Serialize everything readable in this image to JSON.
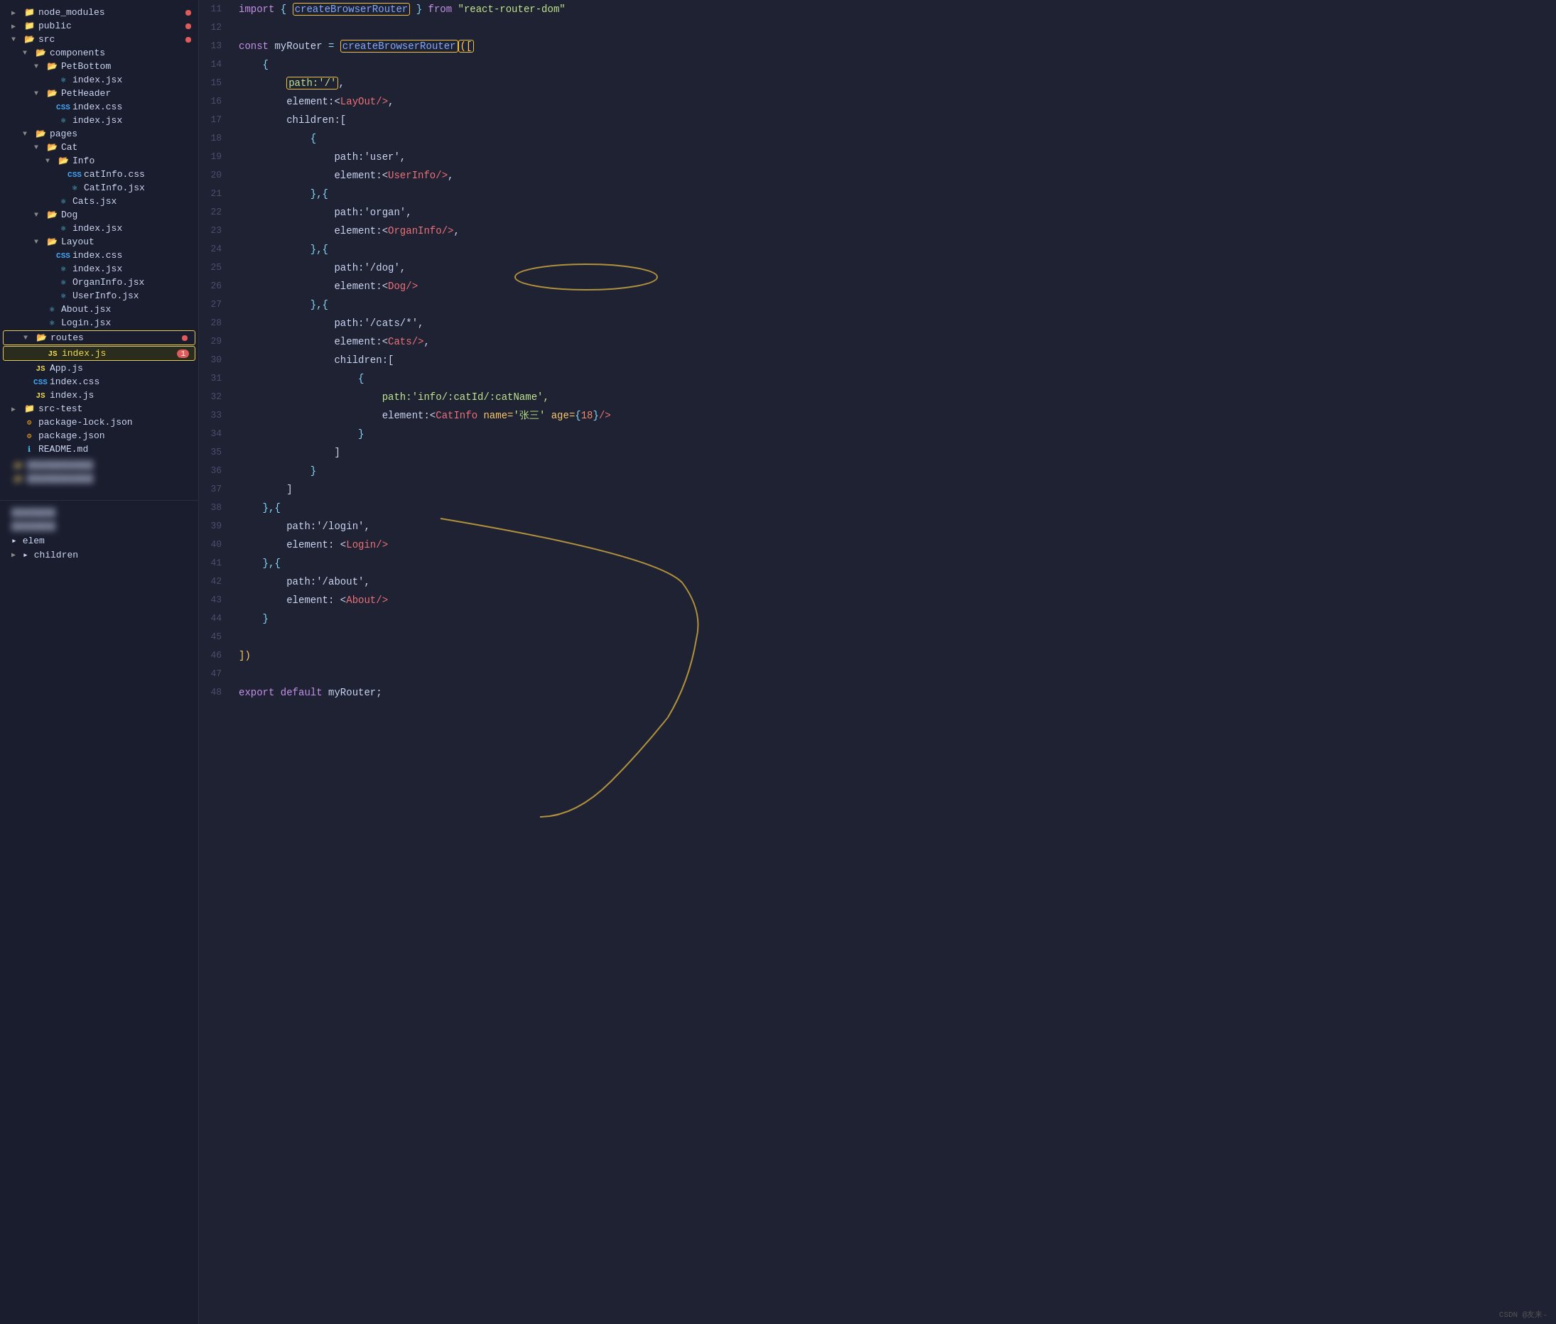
{
  "sidebar": {
    "items": [
      {
        "id": "node_modules",
        "label": "node_modules",
        "indent": 1,
        "type": "folder-collapsed",
        "arrow": "▶",
        "badge": "dot"
      },
      {
        "id": "public",
        "label": "public",
        "indent": 1,
        "type": "folder-collapsed",
        "arrow": "▶",
        "badge": "dot"
      },
      {
        "id": "src",
        "label": "src",
        "indent": 1,
        "type": "folder-open",
        "arrow": "▼",
        "badge": "dot-red"
      },
      {
        "id": "components",
        "label": "components",
        "indent": 2,
        "type": "folder-open",
        "arrow": "▼"
      },
      {
        "id": "PetBottom",
        "label": "PetBottom",
        "indent": 3,
        "type": "folder-open",
        "arrow": "▼"
      },
      {
        "id": "PetBottom-index",
        "label": "index.jsx",
        "indent": 4,
        "type": "jsx"
      },
      {
        "id": "PetHeader",
        "label": "PetHeader",
        "indent": 3,
        "type": "folder-open",
        "arrow": "▼"
      },
      {
        "id": "PetHeader-css",
        "label": "index.css",
        "indent": 4,
        "type": "css"
      },
      {
        "id": "PetHeader-jsx",
        "label": "index.jsx",
        "indent": 4,
        "type": "jsx"
      },
      {
        "id": "pages",
        "label": "pages",
        "indent": 2,
        "type": "folder-open",
        "arrow": "▼"
      },
      {
        "id": "Cat",
        "label": "Cat",
        "indent": 3,
        "type": "folder-open",
        "arrow": "▼"
      },
      {
        "id": "Info",
        "label": "Info",
        "indent": 4,
        "type": "folder-open",
        "arrow": "▼"
      },
      {
        "id": "catInfo-css",
        "label": "catInfo.css",
        "indent": 5,
        "type": "css"
      },
      {
        "id": "CatInfo-jsx",
        "label": "CatInfo.jsx",
        "indent": 5,
        "type": "jsx"
      },
      {
        "id": "Cats-jsx",
        "label": "Cats.jsx",
        "indent": 4,
        "type": "jsx"
      },
      {
        "id": "Dog",
        "label": "Dog",
        "indent": 3,
        "type": "folder-open",
        "arrow": "▼"
      },
      {
        "id": "Dog-index",
        "label": "index.jsx",
        "indent": 4,
        "type": "jsx"
      },
      {
        "id": "Layout",
        "label": "Layout",
        "indent": 3,
        "type": "folder-open",
        "arrow": "▼"
      },
      {
        "id": "Layout-css",
        "label": "index.css",
        "indent": 4,
        "type": "css"
      },
      {
        "id": "Layout-jsx",
        "label": "index.jsx",
        "indent": 4,
        "type": "jsx"
      },
      {
        "id": "OrganInfo-jsx",
        "label": "OrganInfo.jsx",
        "indent": 4,
        "type": "jsx"
      },
      {
        "id": "UserInfo-jsx",
        "label": "UserInfo.jsx",
        "indent": 4,
        "type": "jsx"
      },
      {
        "id": "About-jsx",
        "label": "About.jsx",
        "indent": 3,
        "type": "jsx"
      },
      {
        "id": "Login-jsx",
        "label": "Login.jsx",
        "indent": 3,
        "type": "jsx"
      },
      {
        "id": "routes",
        "label": "routes",
        "indent": 2,
        "type": "folder-open-highlighted",
        "arrow": "▼",
        "badge": "dot-red"
      },
      {
        "id": "routes-index",
        "label": "index.js",
        "indent": 3,
        "type": "js-highlighted",
        "badge": "1"
      },
      {
        "id": "App-js",
        "label": "App.js",
        "indent": 2,
        "type": "js"
      },
      {
        "id": "index-css",
        "label": "index.css",
        "indent": 2,
        "type": "css"
      },
      {
        "id": "index-js2",
        "label": "index.js",
        "indent": 2,
        "type": "js"
      },
      {
        "id": "src-test",
        "label": "src-test",
        "indent": 1,
        "type": "folder-collapsed",
        "arrow": "▶"
      },
      {
        "id": "package-lock",
        "label": "package-lock.json",
        "indent": 1,
        "type": "json"
      },
      {
        "id": "package-json",
        "label": "package.json",
        "indent": 1,
        "type": "json"
      },
      {
        "id": "README",
        "label": "README.md",
        "indent": 1,
        "type": "md"
      }
    ],
    "bottom_blurred_1": "████████████",
    "bottom_blurred_2": "████████████",
    "bottom_section": {
      "item1": "████████",
      "item2": "████████",
      "item3": "elem▸",
      "item4": "▸ children"
    }
  },
  "editor": {
    "lines": [
      {
        "num": 11,
        "tokens": [
          {
            "t": "import ",
            "c": "import-kw"
          },
          {
            "t": "{ ",
            "c": "curly"
          },
          {
            "t": "createBrowserRouter",
            "c": "fn",
            "hl": true
          },
          {
            "t": " }",
            "c": "curly"
          },
          {
            "t": " from ",
            "c": "from-kw"
          },
          {
            "t": "\"react-router-dom\"",
            "c": "str"
          }
        ]
      },
      {
        "num": 12,
        "tokens": []
      },
      {
        "num": 13,
        "tokens": [
          {
            "t": "const ",
            "c": "const-kw"
          },
          {
            "t": "myRouter ",
            "c": "var-name"
          },
          {
            "t": "= ",
            "c": "assign"
          },
          {
            "t": "createBrowserRouter",
            "c": "fn",
            "hl2": true
          },
          {
            "t": "([",
            "c": "bracket",
            "hl2": true
          }
        ]
      },
      {
        "num": 14,
        "tokens": [
          {
            "t": "    {",
            "c": "curly"
          }
        ]
      },
      {
        "num": 15,
        "tokens": [
          {
            "t": "        ",
            "c": "plain"
          },
          {
            "t": "path:'/'",
            "c": "path-str",
            "hl": true
          },
          {
            "t": ",",
            "c": "plain"
          }
        ]
      },
      {
        "num": 16,
        "tokens": [
          {
            "t": "        element:<",
            "c": "plain"
          },
          {
            "t": "LayOut",
            "c": "jsx-tag"
          },
          {
            "t": "/>",
            "c": "jsx-slash"
          },
          {
            "t": ",",
            "c": "plain"
          }
        ]
      },
      {
        "num": 17,
        "tokens": [
          {
            "t": "        children:[",
            "c": "plain"
          }
        ]
      },
      {
        "num": 18,
        "tokens": [
          {
            "t": "            {",
            "c": "curly"
          }
        ]
      },
      {
        "num": 19,
        "tokens": [
          {
            "t": "                path:'user',",
            "c": "plain"
          }
        ]
      },
      {
        "num": 20,
        "tokens": [
          {
            "t": "                element:<",
            "c": "plain"
          },
          {
            "t": "UserInfo",
            "c": "jsx-tag"
          },
          {
            "t": "/>",
            "c": "jsx-slash"
          },
          {
            "t": ",",
            "c": "plain"
          }
        ]
      },
      {
        "num": 21,
        "tokens": [
          {
            "t": "            },{",
            "c": "curly"
          }
        ]
      },
      {
        "num": 22,
        "tokens": [
          {
            "t": "                path:'organ',",
            "c": "plain"
          }
        ]
      },
      {
        "num": 23,
        "tokens": [
          {
            "t": "                element:<",
            "c": "plain"
          },
          {
            "t": "OrganInfo",
            "c": "jsx-tag"
          },
          {
            "t": "/>",
            "c": "jsx-slash"
          },
          {
            "t": ",",
            "c": "plain"
          }
        ]
      },
      {
        "num": 24,
        "tokens": [
          {
            "t": "            },{",
            "c": "curly"
          }
        ]
      },
      {
        "num": 25,
        "tokens": [
          {
            "t": "                path:'/dog',",
            "c": "plain"
          }
        ]
      },
      {
        "num": 26,
        "tokens": [
          {
            "t": "                element:<",
            "c": "plain"
          },
          {
            "t": "Dog",
            "c": "jsx-tag"
          },
          {
            "t": "/>",
            "c": "jsx-slash"
          }
        ]
      },
      {
        "num": 27,
        "tokens": [
          {
            "t": "            },{",
            "c": "curly"
          }
        ]
      },
      {
        "num": 28,
        "tokens": [
          {
            "t": "                path:'/cats/*',",
            "c": "plain"
          }
        ]
      },
      {
        "num": 29,
        "tokens": [
          {
            "t": "                element:<",
            "c": "plain"
          },
          {
            "t": "Cats",
            "c": "jsx-tag"
          },
          {
            "t": "/>",
            "c": "jsx-slash"
          },
          {
            "t": ",",
            "c": "plain"
          }
        ]
      },
      {
        "num": 30,
        "tokens": [
          {
            "t": "                children:[",
            "c": "plain"
          }
        ]
      },
      {
        "num": 31,
        "tokens": [
          {
            "t": "                    {",
            "c": "curly"
          }
        ]
      },
      {
        "num": 32,
        "tokens": [
          {
            "t": "                        path:'info/:catId/:catName',",
            "c": "path-str"
          }
        ]
      },
      {
        "num": 33,
        "tokens": [
          {
            "t": "                        element:<",
            "c": "plain"
          },
          {
            "t": "CatInfo ",
            "c": "jsx-tag"
          },
          {
            "t": "name=",
            "c": "attr-name"
          },
          {
            "t": "'张三'",
            "c": "attr-val"
          },
          {
            "t": " age=",
            "c": "attr-name"
          },
          {
            "t": "{",
            "c": "curly"
          },
          {
            "t": "18",
            "c": "num"
          },
          {
            "t": "}",
            "c": "curly"
          },
          {
            "t": "/>",
            "c": "jsx-slash"
          }
        ]
      },
      {
        "num": 34,
        "tokens": [
          {
            "t": "                    }",
            "c": "curly"
          }
        ]
      },
      {
        "num": 35,
        "tokens": [
          {
            "t": "                ]",
            "c": "plain"
          }
        ]
      },
      {
        "num": 36,
        "tokens": [
          {
            "t": "            }",
            "c": "curly"
          }
        ]
      },
      {
        "num": 37,
        "tokens": [
          {
            "t": "        ]",
            "c": "plain"
          }
        ]
      },
      {
        "num": 38,
        "tokens": [
          {
            "t": "    },{",
            "c": "curly"
          }
        ]
      },
      {
        "num": 39,
        "tokens": [
          {
            "t": "        path:'/login',",
            "c": "plain"
          }
        ]
      },
      {
        "num": 40,
        "tokens": [
          {
            "t": "        element: <",
            "c": "plain"
          },
          {
            "t": "Login",
            "c": "jsx-tag"
          },
          {
            "t": "/>",
            "c": "jsx-slash"
          }
        ]
      },
      {
        "num": 41,
        "tokens": [
          {
            "t": "    },{",
            "c": "curly"
          }
        ]
      },
      {
        "num": 42,
        "tokens": [
          {
            "t": "        path:'/about',",
            "c": "plain"
          }
        ]
      },
      {
        "num": 43,
        "tokens": [
          {
            "t": "        element: <",
            "c": "plain"
          },
          {
            "t": "About",
            "c": "jsx-tag"
          },
          {
            "t": "/>",
            "c": "jsx-slash"
          }
        ]
      },
      {
        "num": 44,
        "tokens": [
          {
            "t": "    }",
            "c": "curly"
          }
        ]
      },
      {
        "num": 45,
        "tokens": []
      },
      {
        "num": 46,
        "tokens": [
          {
            "t": "])",
            "c": "bracket"
          }
        ]
      },
      {
        "num": 47,
        "tokens": []
      },
      {
        "num": 48,
        "tokens": [
          {
            "t": "export ",
            "c": "export-kw"
          },
          {
            "t": "default ",
            "c": "default-kw"
          },
          {
            "t": "myRouter",
            "c": "var-name"
          },
          {
            "t": ";",
            "c": "plain"
          }
        ]
      }
    ]
  },
  "watermark": "CSDN @友来-"
}
